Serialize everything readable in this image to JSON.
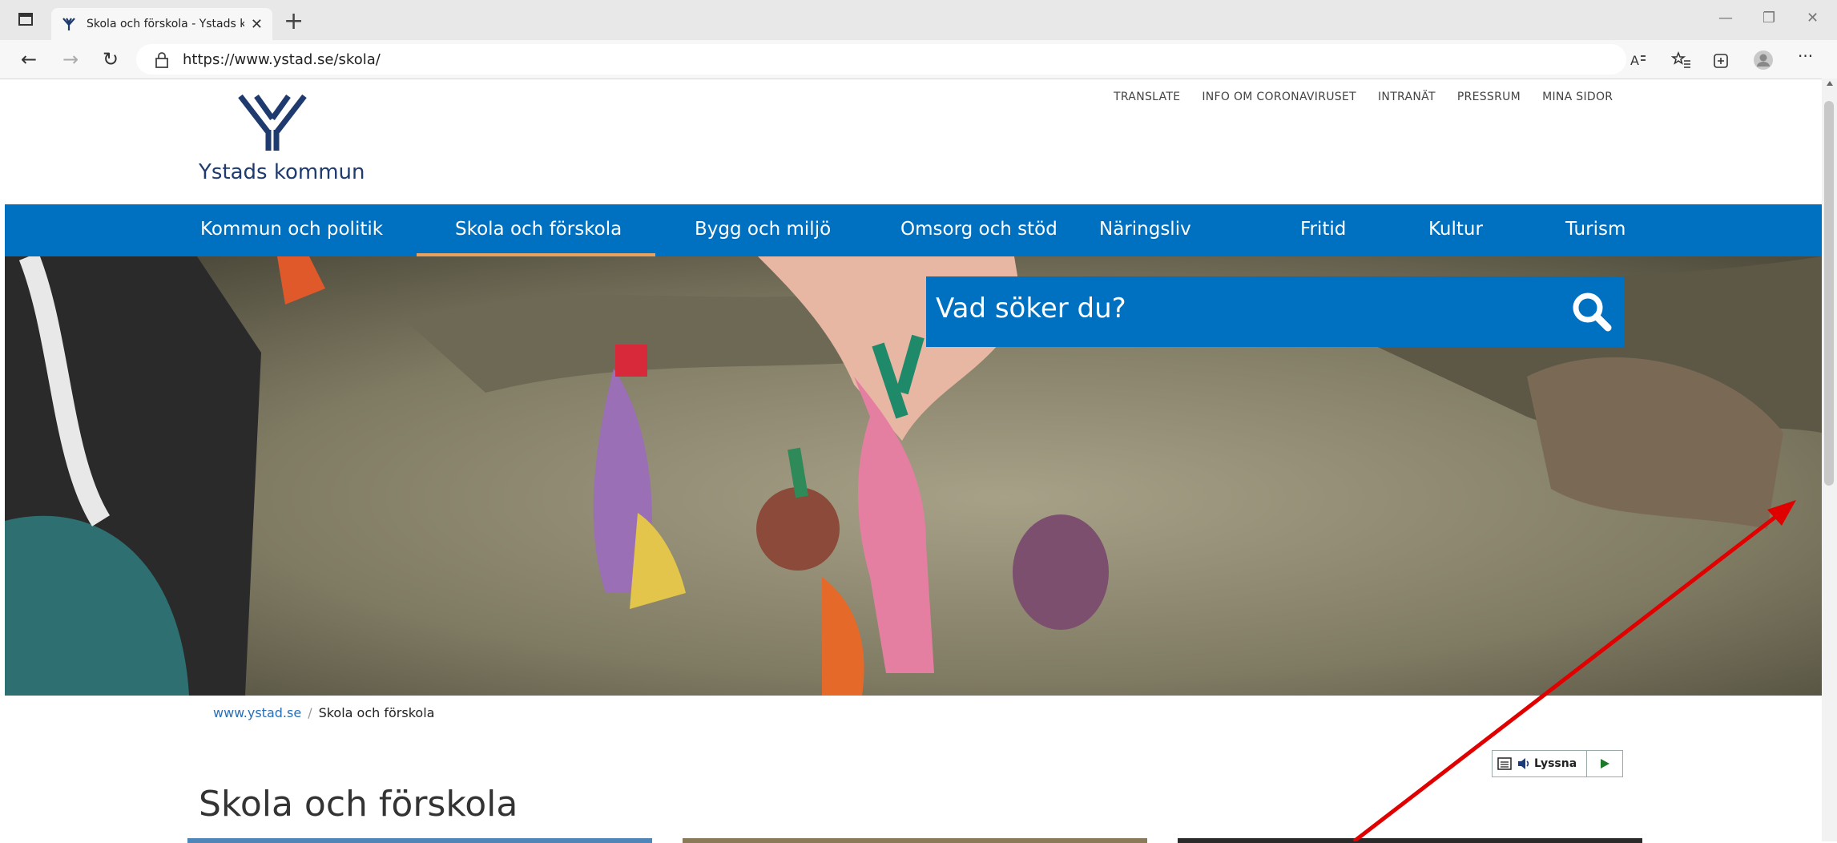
{
  "browser": {
    "tab_title": "Skola och förskola - Ystads komr",
    "url": "https://www.ystad.se/skola/",
    "new_tab": "+",
    "close": "✕",
    "minimize": "—",
    "restore": "❐",
    "window_close": "✕",
    "back": "←",
    "forward": "→",
    "reload": "↻",
    "menu": "···"
  },
  "site": {
    "logo_text": "Ystads kommun",
    "top_links": [
      "TRANSLATE",
      "INFO OM CORONAVIRUSET",
      "INTRANÄT",
      "PRESSRUM",
      "MINA SIDOR"
    ],
    "main_nav": [
      "Kommun och politik",
      "Skola och förskola",
      "Bygg och miljö",
      "Omsorg och stöd",
      "Näringsliv",
      "Fritid",
      "Kultur",
      "Turism"
    ],
    "active_nav": "Skola och förskola",
    "search_placeholder": "Vad söker du?",
    "breadcrumb": {
      "home": "www.ystad.se",
      "separator": "/",
      "current": "Skola och förskola"
    },
    "listen_label": "Lyssna",
    "page_title": "Skola och förskola"
  },
  "colors": {
    "brand_blue": "#0070c0",
    "active_underline": "#e8a15e",
    "logo_navy": "#1f3a6e",
    "annotation_arrow": "#e00000"
  },
  "icons": [
    "tab-toggle-icon",
    "favicon-icon",
    "lock-icon",
    "read-aloud-icon",
    "favorites-icon",
    "collections-icon",
    "profile-icon",
    "search-icon",
    "speaker-icon",
    "play-icon"
  ]
}
